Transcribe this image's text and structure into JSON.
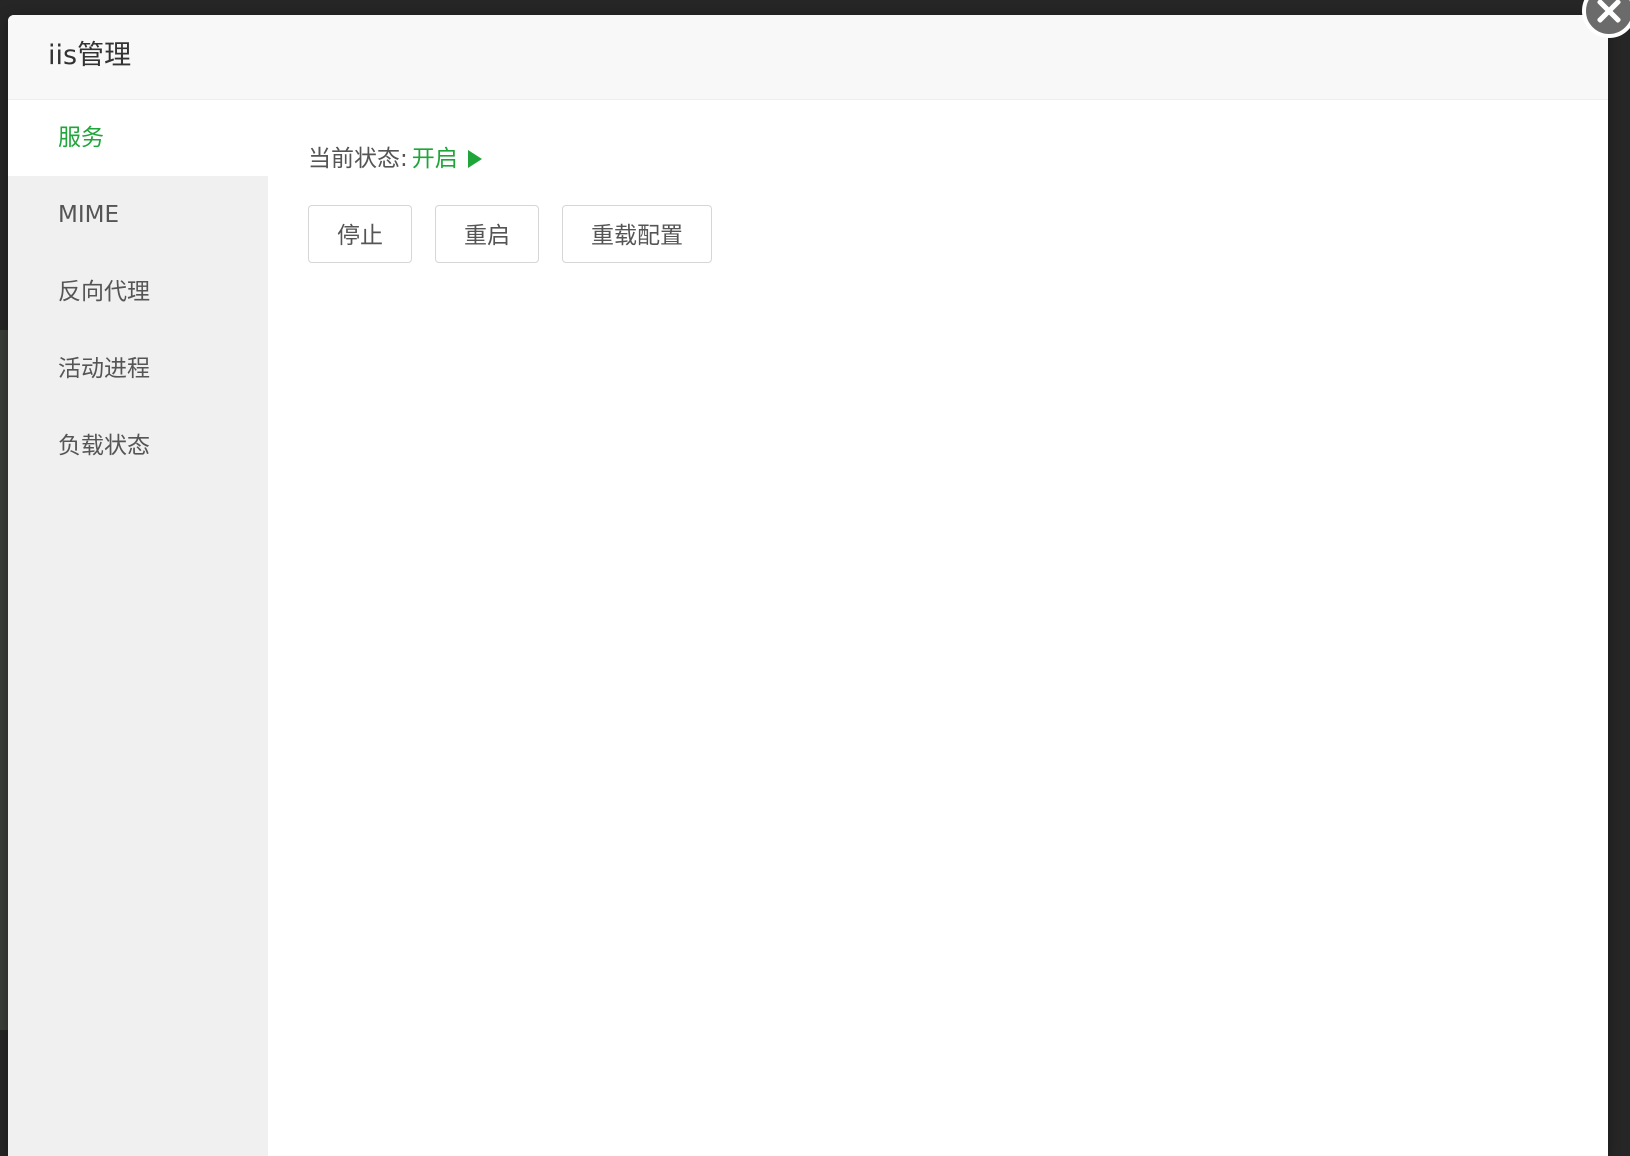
{
  "dialog": {
    "title": "iis管理"
  },
  "sidebar": {
    "items": [
      {
        "label": "服务",
        "active": true
      },
      {
        "label": "MIME",
        "active": false
      },
      {
        "label": "反向代理",
        "active": false
      },
      {
        "label": "活动进程",
        "active": false
      },
      {
        "label": "负载状态",
        "active": false
      }
    ]
  },
  "service": {
    "status_label": "当前状态:",
    "status_value": "开启",
    "status_icon": "play-icon",
    "buttons": {
      "stop": "停止",
      "restart": "重启",
      "reload": "重载配置"
    }
  },
  "colors": {
    "accent": "#20a53a",
    "text": "#555555",
    "sidebar_bg": "#f0f0f0",
    "header_bg": "#f8f8f8"
  },
  "icons": {
    "close": "close-icon"
  }
}
